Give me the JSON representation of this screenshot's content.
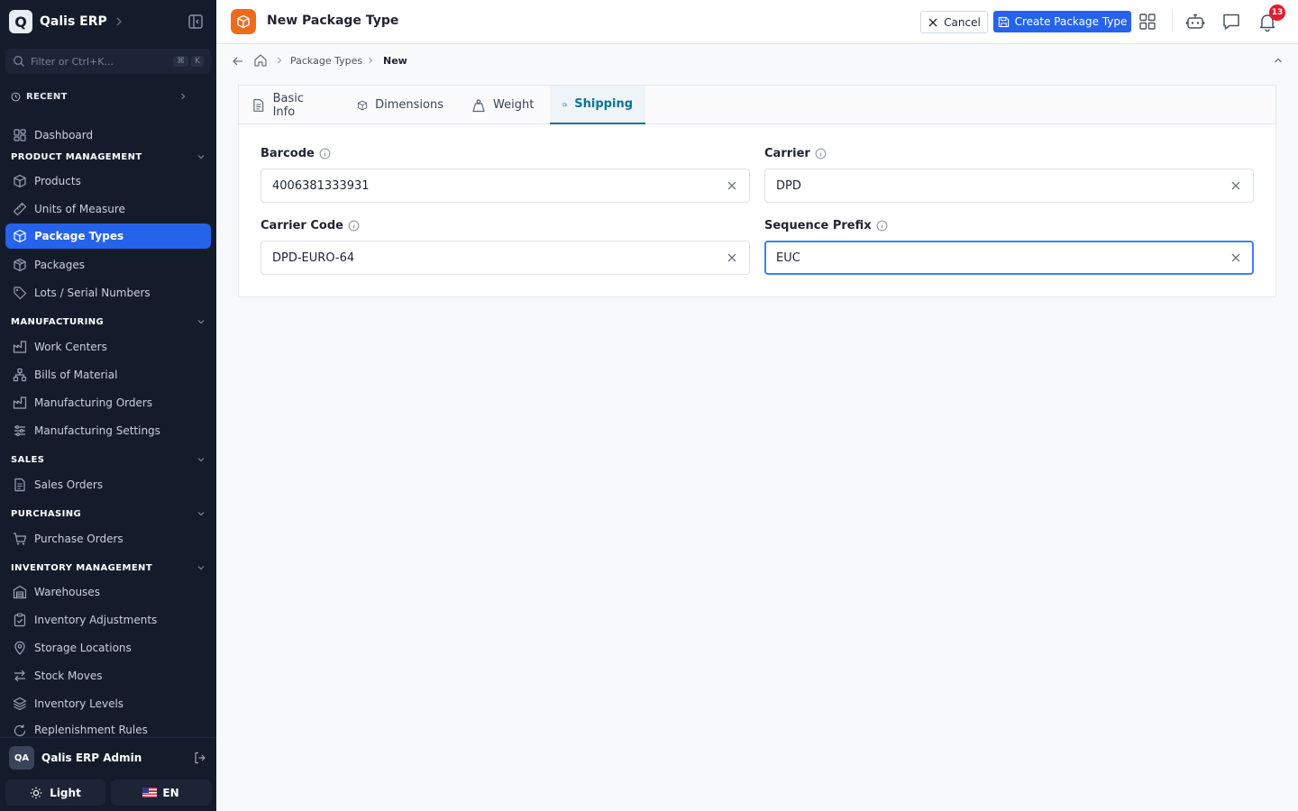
{
  "sidebar": {
    "brand": {
      "logo_letter": "Q",
      "name": "Qalis ERP"
    },
    "filter_placeholder": "Filter or Ctrl+K...",
    "filter_kbd": [
      "⌘",
      "K"
    ],
    "recent_label": "RECENT",
    "dashboard": "Dashboard",
    "sections": {
      "product_management": "PRODUCT MANAGEMENT",
      "manufacturing": "MANUFACTURING",
      "sales": "SALES",
      "purchasing": "PURCHASING",
      "inventory_management": "INVENTORY MANAGEMENT"
    },
    "items": {
      "products": "Products",
      "units_of_measure": "Units of Measure",
      "package_types": "Package Types",
      "packages": "Packages",
      "lots_serial": "Lots / Serial Numbers",
      "work_centers": "Work Centers",
      "bills_of_material": "Bills of Material",
      "manufacturing_orders": "Manufacturing Orders",
      "manufacturing_settings": "Manufacturing Settings",
      "sales_orders": "Sales Orders",
      "purchase_orders": "Purchase Orders",
      "warehouses": "Warehouses",
      "inventory_adjustments": "Inventory Adjustments",
      "storage_locations": "Storage Locations",
      "stock_moves": "Stock Moves",
      "inventory_levels": "Inventory Levels",
      "replenishment_rules": "Replenishment Rules"
    },
    "user": {
      "initials": "QA",
      "name": "Qalis ERP Admin"
    },
    "theme_label": "Light",
    "language_label": "EN"
  },
  "header": {
    "title": "New Package Type",
    "cancel_label": "Cancel",
    "create_label": "Create Package Type",
    "notification_count": "13"
  },
  "breadcrumb": {
    "parent": "Package Types",
    "current": "New"
  },
  "tabs": [
    {
      "label": "Basic Info",
      "icon": "document-icon"
    },
    {
      "label": "Dimensions",
      "icon": "cube-icon"
    },
    {
      "label": "Weight",
      "icon": "weight-icon"
    },
    {
      "label": "Shipping",
      "icon": "truck-icon",
      "active": true
    }
  ],
  "form": {
    "barcode": {
      "label": "Barcode",
      "value": "4006381333931"
    },
    "carrier": {
      "label": "Carrier",
      "value": "DPD"
    },
    "carrier_code": {
      "label": "Carrier Code",
      "value": "DPD-EURO-64"
    },
    "sequence_prefix": {
      "label": "Sequence Prefix",
      "value": "EUC"
    }
  },
  "colors": {
    "sidebar_bg": "#141c2c",
    "accent": "#2563eb",
    "tab_active": "#0e7490",
    "page_icon": "#f06a1c",
    "badge": "#e11d2e"
  }
}
